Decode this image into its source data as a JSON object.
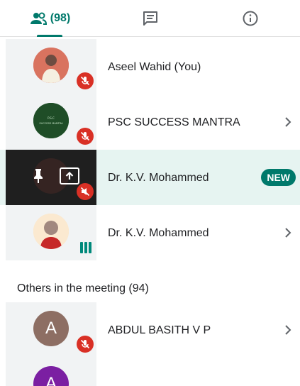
{
  "tabs": {
    "people_count": "(98)",
    "icons": [
      "people-icon",
      "chat-icon",
      "info-icon"
    ],
    "accent_color": "#00796b"
  },
  "participants": [
    {
      "name": "Aseel Wahid (You)",
      "muted": true
    },
    {
      "name": "PSC SUCCESS MANTRA",
      "muted": true,
      "avatar_text": "P.S.C SUCCESS MANTRA"
    },
    {
      "name": "Dr. K.V. Mohammed",
      "muted": true,
      "presenting": true,
      "badge": "NEW"
    },
    {
      "name": "Dr. K.V. Mohammed",
      "speaking": true
    }
  ],
  "others": {
    "title": "Others in the meeting (94)",
    "items": [
      {
        "name": "ABDUL BASITH V P",
        "initial": "A",
        "avatar_color": "#8d6e63",
        "muted": true
      },
      {
        "name": "",
        "initial": "A",
        "avatar_color": "#7b1fa2"
      }
    ]
  }
}
